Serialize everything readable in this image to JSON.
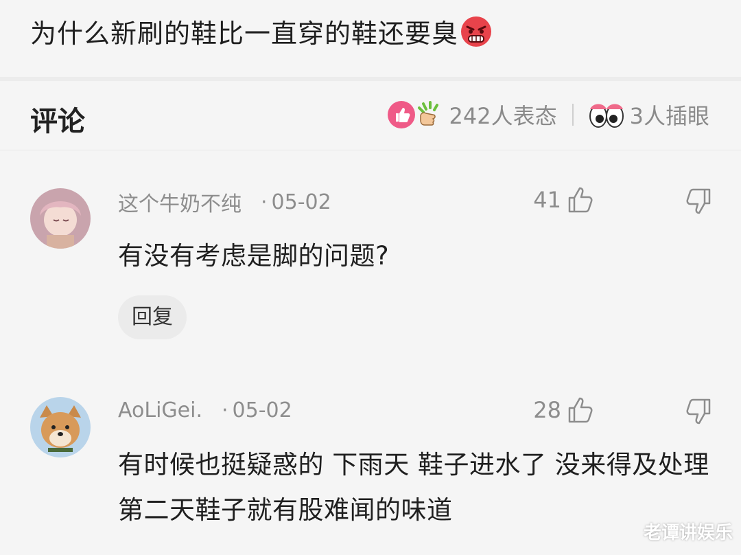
{
  "post": {
    "text": "为什么新刷的鞋比一直穿的鞋还要臭",
    "emoji_icon": "angry-face-icon"
  },
  "comments_header": {
    "title": "评论",
    "reaction_count": "242人表态",
    "glance_count": "3人插眼"
  },
  "comments": [
    {
      "username": "这个牛奶不纯",
      "date": "05-02",
      "likes": "41",
      "text": "有没有考虑是脚的问题?",
      "reply_label": "回复"
    },
    {
      "username": "AoLiGei.",
      "date": "05-02",
      "likes": "28",
      "text": "有时候也挺疑惑的 下雨天 鞋子进水了 没来得及处理 第二天鞋子就有股难闻的味道"
    }
  ],
  "watermark": "老谭讲娱乐",
  "colors": {
    "background": "#f5f5f5",
    "text_primary": "#1f1f1f",
    "text_secondary": "#8d8d8d",
    "reaction_pink": "#ef5a87"
  }
}
